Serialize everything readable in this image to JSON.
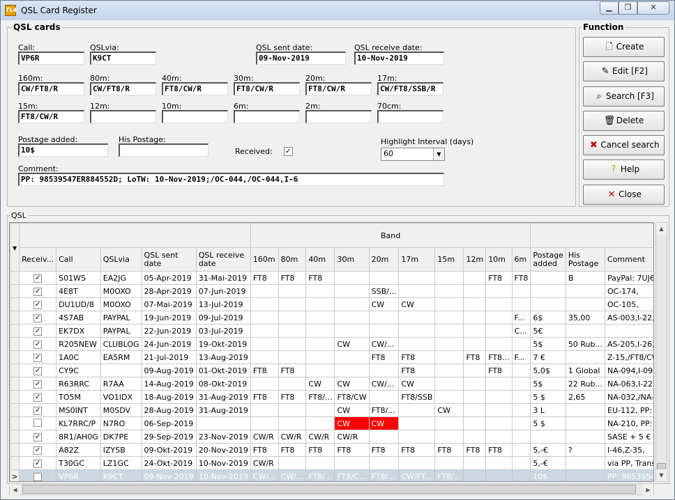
{
  "window": {
    "title": "QSL Card Register",
    "app_icon_text": "TL4"
  },
  "qsl_cards": {
    "group_label": "QSL cards",
    "call": {
      "label": "Call:",
      "value": "VP6R"
    },
    "qslvia": {
      "label": "QSLvia:",
      "value": "K9CT"
    },
    "sent_date": {
      "label": "QSL sent date:",
      "value": "09-Nov-2019"
    },
    "receive_date": {
      "label": "QSL receive date:",
      "value": "10-Nov-2019"
    },
    "bands": [
      {
        "label": "160m:",
        "value": "CW/FT8/R"
      },
      {
        "label": "80m:",
        "value": "CW/FT8/R"
      },
      {
        "label": "40m:",
        "value": "FT8/CW/R"
      },
      {
        "label": "30m:",
        "value": "FT8/CW/R"
      },
      {
        "label": "20m:",
        "value": "FT8/CW/R"
      },
      {
        "label": "17m:",
        "value": "CW/FT8/SSB/R"
      },
      {
        "label": "15m:",
        "value": "FT8/CW/R"
      },
      {
        "label": "12m:",
        "value": ""
      },
      {
        "label": "10m:",
        "value": ""
      },
      {
        "label": "6m:",
        "value": ""
      },
      {
        "label": "2m:",
        "value": ""
      },
      {
        "label": "70cm:",
        "value": ""
      }
    ],
    "postage_added": {
      "label": "Postage added:",
      "value": "10$"
    },
    "his_postage": {
      "label": "His Postage:",
      "value": ""
    },
    "received": {
      "label": "Received:",
      "checked": "✓"
    },
    "highlight": {
      "label": "Highlight Interval (days)",
      "value": "60"
    },
    "comment": {
      "label": "Comment:",
      "value": "PP: 98539547ER884552D; LoTW: 10-Nov-2019;/OC-044,/OC-044,I-6"
    }
  },
  "function": {
    "group_label": "Function",
    "buttons": [
      {
        "label": "Create",
        "icon": "new-document-icon"
      },
      {
        "label": "Edit [F2]",
        "icon": "edit-icon"
      },
      {
        "label": "Search [F3]",
        "icon": "binoculars-icon"
      },
      {
        "label": "Delete",
        "icon": "trash-icon"
      },
      {
        "label": "Cancel search",
        "icon": "cancel-search-icon"
      },
      {
        "label": "Help",
        "icon": "question-icon"
      },
      {
        "label": "Close",
        "icon": "close-icon"
      }
    ]
  },
  "qsl_grid": {
    "group_label": "QSL",
    "band_header": "Band",
    "columns": [
      "Receiv...",
      "Call",
      "QSLvia",
      "QSL sent date",
      "QSL receive date",
      "160m",
      "80m",
      "40m",
      "30m",
      "20m",
      "17m",
      "15m",
      "12m",
      "10m",
      "6m",
      "Postage added",
      "His Postage",
      "Comment"
    ],
    "rows": [
      [
        "✓",
        "S01WS",
        "EA2JG",
        "05-Apr-2019",
        "31-Mai-2019",
        "FT8",
        "FT8",
        "FT8",
        "",
        "",
        "",
        "",
        "",
        "FT8",
        "FT8",
        "",
        "B",
        "PayPal: 7UJ639..."
      ],
      [
        "✓",
        "4E8T",
        "M0OXO",
        "28-Apr-2019",
        "07-Jun-2019",
        "",
        "",
        "",
        "",
        "SSB/...",
        "",
        "",
        "",
        "",
        "",
        "",
        "",
        "OC-174,"
      ],
      [
        "✓",
        "DU1UD/8",
        "M0OXO",
        "07-Mai-2019",
        "13-Jul-2019",
        "",
        "",
        "",
        "",
        "CW",
        "CW",
        "",
        "",
        "",
        "",
        "",
        "",
        "OC-105,"
      ],
      [
        "✓",
        "4S7AB",
        "PAYPAL",
        "19-Jun-2019",
        "09-Jul-2019",
        "",
        "",
        "",
        "",
        "",
        "",
        "",
        "",
        "",
        "F...",
        "6$",
        "35,00",
        "AS-003,I-22, An:..."
      ],
      [
        "✓",
        "EK7DX",
        "PAYPAL",
        "22-Jun-2019",
        "03-Jul-2019",
        "",
        "",
        "",
        "",
        "",
        "",
        "",
        "",
        "",
        "C...",
        "5€",
        "",
        ""
      ],
      [
        "✓",
        "R205NEW",
        "CLUBLOG",
        "24-Jun-2019",
        "19-Okt-2019",
        "",
        "",
        "",
        "CW",
        "CW/...",
        "",
        "",
        "",
        "",
        "",
        "5$",
        "50 Rub...",
        "AS-205,I-26,Z-1..."
      ],
      [
        "✓",
        "1A0C",
        "EA5RM",
        "21-Jul-2019",
        "13-Aug-2019",
        "",
        "",
        "",
        "",
        "FT8",
        "FT8",
        "",
        "FT8",
        "FT8...",
        "F...",
        "7 €",
        "",
        "Z-15,/FT8/CW/..."
      ],
      [
        "✓",
        "CY9C",
        "",
        "09-Aug-2019",
        "01-Okt-2019",
        "FT8",
        "FT8",
        "",
        "",
        "",
        "FT8",
        "",
        "",
        "FT8",
        "",
        "5,0$",
        "1 Global",
        "NA-094,I-09,Z-0..."
      ],
      [
        "✓",
        "R63RRC",
        "R7AA",
        "14-Aug-2019",
        "08-Okt-2019",
        "",
        "",
        "CW",
        "CW",
        "CW/...",
        "CW",
        "",
        "",
        "",
        "",
        "5$",
        "22 Rub...",
        "NA-063,I-22,Z-1..."
      ],
      [
        "✓",
        "TO5M",
        "VO1IDX",
        "18-Aug-2019",
        "31-Aug-2019",
        "FT8",
        "FT8",
        "FT8/...",
        "FT8/CW",
        "",
        "FT8/SSB",
        "",
        "",
        "",
        "",
        "5 $",
        "2,65",
        "NA-032,/NA-032..."
      ],
      [
        "✓",
        "MS0INT",
        "M0SDV",
        "28-Aug-2019",
        "31-Aug-2019",
        "",
        "",
        "",
        "CW",
        "FT8/...",
        "",
        "CW",
        "",
        "",
        "",
        "3 L",
        "",
        "EU-112,  PP: 1F..."
      ],
      [
        "",
        "KL7RRC/P",
        "N7RO",
        "06-Sep-2019",
        "",
        "",
        "",
        "",
        "CW",
        "CW",
        "",
        "",
        "",
        "",
        "",
        "5 $",
        "",
        "NA-210, PP: 37..."
      ],
      [
        "✓",
        "8R1/AH0G",
        "DK7PE",
        "29-Sep-2019",
        "23-Nov-2019",
        "CW/R",
        "CW/R",
        "CW/R",
        "CW/R",
        "",
        "",
        "",
        "",
        "",
        "",
        "",
        "",
        "SASE + 5 €"
      ],
      [
        "✓",
        "A82Z",
        "IZYSB",
        "09-Okt-2019",
        "20-Nov-2019",
        "FT8",
        "FT8",
        "FT8",
        "FT8",
        "FT8",
        "FT8",
        "FT8",
        "FT8",
        "FT8",
        "",
        "5,-€",
        "?",
        "I-46,Z-35,"
      ],
      [
        "✓",
        "T30GC",
        "LZ1GC",
        "24-Okt-2019",
        "10-Nov-2019",
        "CW/R",
        "",
        "",
        "",
        "",
        "",
        "",
        "",
        "",
        "",
        "5,-€",
        "",
        "via PP, Transakt..."
      ],
      [
        "✓",
        "VP6R",
        "K9CT",
        "09-Nov-2019",
        "10-Nov-2019",
        "CW/...",
        "CW/...",
        "FT8/...",
        "FT8/C...",
        "FT8/...",
        "CW/FT...",
        "FT8/...",
        "",
        "",
        "",
        "10$",
        "",
        "PP: 98539547E..."
      ]
    ],
    "selected_row_index": 15,
    "highlighted_cells": [
      [
        11,
        8
      ],
      [
        11,
        9
      ]
    ],
    "highlight_color": "#ff0000",
    "selection_color": "#cdd7e2"
  }
}
